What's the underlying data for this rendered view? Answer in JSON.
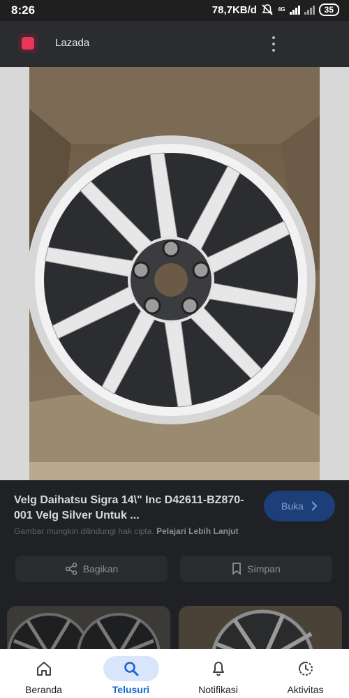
{
  "status_bar": {
    "time": "8:26",
    "network_speed": "78,7KB/d",
    "network_type": "4G",
    "battery": "35",
    "icons": [
      "mute-icon",
      "signal-icon",
      "battery-icon"
    ]
  },
  "app_bar": {
    "title": "Lazada",
    "icon": "lazada-logo-icon",
    "menu_icon": "more-vert-icon"
  },
  "result": {
    "title": "Velg Daihatsu Sigra 14\\\" Inc D42611-BZ870-001 Velg Silver Untuk ...",
    "visit_label": "Buka",
    "visit_icon": "chevron-right-icon",
    "copyright_text": "Gambar mungkin dilindungi hak cipta.",
    "learn_more": "Pelajari Lebih Lanjut",
    "share_label": "Bagikan",
    "save_label": "Simpan"
  },
  "bottom_nav": {
    "items": [
      {
        "label": "Beranda",
        "icon": "home-icon",
        "active": false
      },
      {
        "label": "Telusuri",
        "icon": "search-icon",
        "active": true
      },
      {
        "label": "Notifikasi",
        "icon": "bell-icon",
        "active": false
      },
      {
        "label": "Aktivitas",
        "icon": "history-icon",
        "active": false
      }
    ]
  },
  "colors": {
    "accent": "#1a66d2",
    "active_nav_bg": "#d8e5fb",
    "scrim": "#202124"
  }
}
